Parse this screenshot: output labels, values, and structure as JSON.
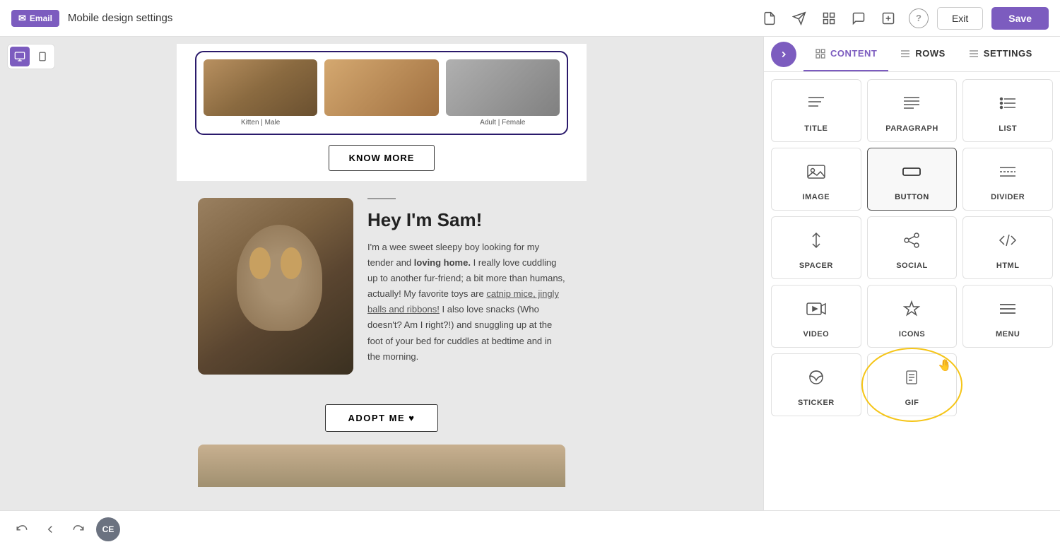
{
  "topbar": {
    "email_label": "Email",
    "title": "Mobile design settings",
    "help_label": "?",
    "exit_label": "Exit",
    "save_label": "Save",
    "icons": [
      "document-icon",
      "send-icon",
      "grid-icon",
      "chat-icon",
      "add-block-icon"
    ]
  },
  "canvas": {
    "cats_section": {
      "cat1_label": "Kitten | Male",
      "cat2_label": "",
      "cat3_label": "Adult | Female"
    },
    "know_more_btn": "KNOW MORE",
    "sam": {
      "title": "Hey I'm Sam!",
      "description_1": "I'm a wee sweet sleepy boy looking for my tender and ",
      "description_bold": "loving home.",
      "description_2": " I really love cuddling up to another fur-friend; a bit more than humans, actually! My favorite toys are ",
      "description_link": "catnip mice, jingly balls and ribbons!",
      "description_3": " I also love snacks (Who doesn't? Am I right?!) and snuggling up at the foot of your bed for cuddles at bedtime and in the morning."
    },
    "adopt_btn": "ADOPT ME ♥",
    "bottom_partial": true
  },
  "bottombar": {
    "undo_label": "↩",
    "back_label": "←",
    "redo_label": "↪",
    "avatar_label": "CE"
  },
  "panel": {
    "toggle_icon": "›",
    "tabs": [
      {
        "id": "content",
        "label": "CONTENT",
        "active": true
      },
      {
        "id": "rows",
        "label": "ROWS",
        "active": false
      },
      {
        "id": "settings",
        "label": "SETTINGS",
        "active": false
      }
    ],
    "widgets": [
      {
        "id": "title",
        "label": "TITLE",
        "icon": "title-icon"
      },
      {
        "id": "paragraph",
        "label": "PARAGRAPH",
        "icon": "paragraph-icon"
      },
      {
        "id": "list",
        "label": "LIST",
        "icon": "list-icon"
      },
      {
        "id": "image",
        "label": "IMAGE",
        "icon": "image-icon"
      },
      {
        "id": "button",
        "label": "BUTTON",
        "icon": "button-icon"
      },
      {
        "id": "divider",
        "label": "DIVIDER",
        "icon": "divider-icon"
      },
      {
        "id": "spacer",
        "label": "SPACER",
        "icon": "spacer-icon"
      },
      {
        "id": "social",
        "label": "SOCIAL",
        "icon": "social-icon"
      },
      {
        "id": "html",
        "label": "HTML",
        "icon": "html-icon"
      },
      {
        "id": "video",
        "label": "VIDEO",
        "icon": "video-icon"
      },
      {
        "id": "icons",
        "label": "ICONS",
        "icon": "icons-star-icon"
      },
      {
        "id": "menu",
        "label": "MENU",
        "icon": "menu-icon"
      },
      {
        "id": "sticker",
        "label": "STICKER",
        "icon": "sticker-icon"
      },
      {
        "id": "gif",
        "label": "GIF",
        "icon": "gif-icon",
        "highlighted": true
      }
    ]
  }
}
